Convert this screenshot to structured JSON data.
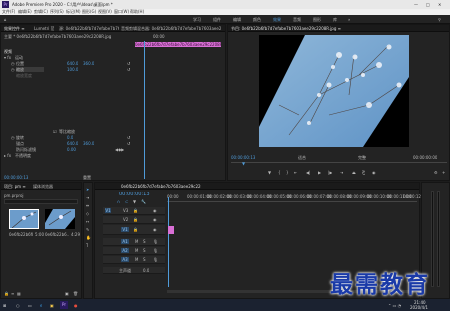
{
  "app": {
    "title": "Adobe Premiere Pro 2020 - C:\\用户\\Ideas\\桌面\\pm *"
  },
  "menu": [
    "文件(F)",
    "编辑(E)",
    "剪辑(C)",
    "序列(S)",
    "标记(M)",
    "图形(G)",
    "视图(V)",
    "窗口(W)",
    "帮助(H)"
  ],
  "workspaces": [
    "学习",
    "组件",
    "编辑",
    "颜色",
    "效果",
    "音频",
    "图形",
    "库",
    "»"
  ],
  "effect_controls": {
    "tabs": [
      "效果控件 ≡",
      "Lumetri 范围",
      "源: 0e6fb22b6fb7d7efabe7b7603aee29c2208R.jpg",
      "音频剪辑混合器: 0e6fb22b6fb7d7efabe7b7603aee29c2208R"
    ],
    "source_label": "主要 * 0e6fb22b6fb7d7efabe7b7603aee29c2208R.jpg",
    "clip_label": "0e6fb22b6fb7d7efabe7b7603aee29c2208R.jpg",
    "timecode_top": "00:00",
    "section_video": "视频",
    "fx_motion": "运动",
    "prop_position": "位置",
    "val_position_x": "640.0",
    "val_position_y": "360.0",
    "prop_scale": "缩放",
    "val_scale": "100.0",
    "prop_scale_width": "缩放宽度",
    "prop_uniform": "等比缩放",
    "prop_rotation": "旋转",
    "val_rotation": "0.0",
    "prop_anchor": "锚点",
    "val_anchor_x": "640.0",
    "val_anchor_y": "360.0",
    "prop_flicker": "防闪烁滤镜",
    "val_flicker": "0.00",
    "prop_opacity": "不透明度",
    "reset_label": "重置",
    "timecode_bottom": "00:00:00:13",
    "section_audio": "时间重映射"
  },
  "program": {
    "tab": "节目: 0e6fb22b6fb7d7efabe7b7603aee29c2208R.jpg ≡",
    "timecode_left": "00:00:00:13",
    "fit": "适合",
    "quality": "完整",
    "timecode_right": "00:00:00:00"
  },
  "project": {
    "tabs": [
      "项目: pm ≡",
      "媒体浏览器"
    ],
    "name": "pm.prproj",
    "item1_name": "0e6fb22b6fb...",
    "item1_dur": "5:00",
    "item2_name": "0e6fb22b6...",
    "item2_dur": "4:29"
  },
  "timeline": {
    "tab": "0e6fb22b6fb7d7efabe7b7603aee29c2208R.jpg ≡",
    "timecode": "00:00:00:13",
    "ruler": [
      "00:00",
      "00:00:01:00",
      "00:00:02:00",
      "00:00:03:00",
      "00:00:04:00",
      "00:00:05:00",
      "00:00:06:00",
      "00:00:07:00",
      "00:00:08:00",
      "00:00:09:00",
      "00:00:10:00",
      "00:00:11:00",
      "00:00:12:00"
    ],
    "tracks_video": [
      "V3",
      "V2",
      "V1"
    ],
    "tracks_audio": [
      "A1",
      "A2",
      "A3"
    ],
    "master": "主声道",
    "master_val": "0.0"
  },
  "watermark": "最需教育",
  "taskbar": {
    "time": "21:40",
    "date": "2020/4/1"
  }
}
